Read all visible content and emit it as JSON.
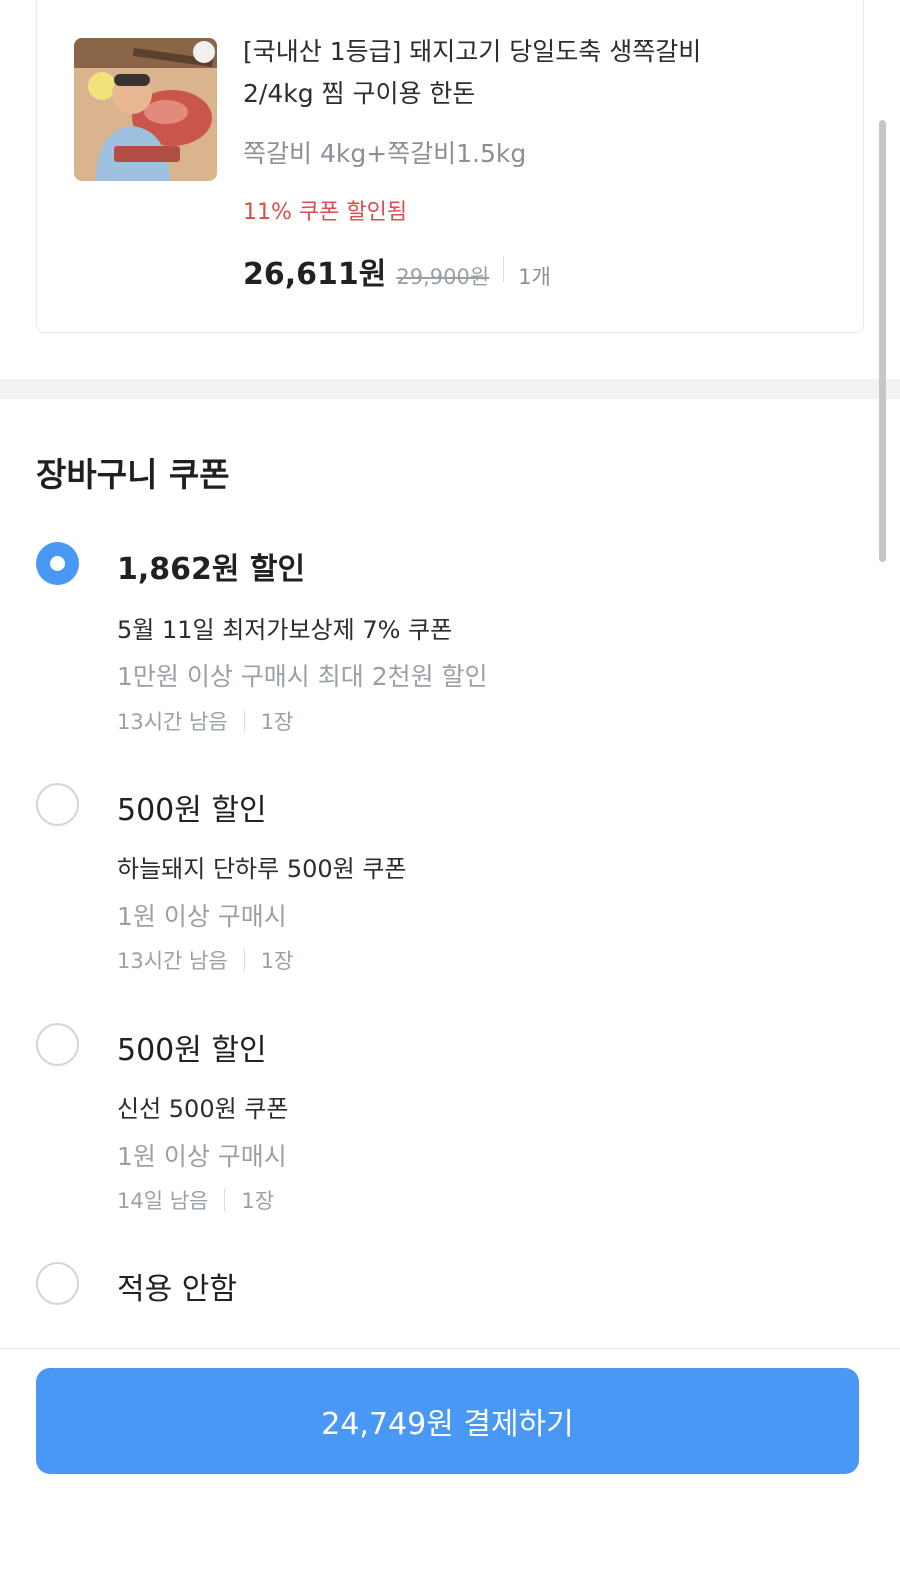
{
  "product": {
    "title_line1": "[국내산 1등급] 돼지고기 당일도축 생쪽갈비",
    "title_line2": "2/4kg 찜 구이용 한돈",
    "option": "쪽갈비 4kg+쪽갈비1.5kg",
    "discount": "11% 쿠폰 할인됨",
    "price": "26,611원",
    "original_price": "29,900원",
    "quantity": "1개"
  },
  "section_title": "장바구니 쿠폰",
  "coupons": [
    {
      "amount": "1,862원 할인",
      "name": "5월 11일 최저가보상제 7% 쿠폰",
      "condition": "1만원 이상 구매시 최대 2천원 할인",
      "remaining": "13시간 남음",
      "count": "1장",
      "selected": true
    },
    {
      "amount": "500원 할인",
      "name": "하늘돼지 단하루 500원 쿠폰",
      "condition": "1원 이상 구매시",
      "remaining": "13시간 남음",
      "count": "1장",
      "selected": false
    },
    {
      "amount": "500원 할인",
      "name": "신선 500원 쿠폰",
      "condition": "1원 이상 구매시",
      "remaining": "14일 남음",
      "count": "1장",
      "selected": false
    }
  ],
  "no_coupon_label": "적용 안함",
  "pay_button_label": "24,749원 결제하기",
  "colors": {
    "accent": "#4a98f5",
    "discount_red": "#e14b4b",
    "muted_text": "#9aa0a6"
  }
}
